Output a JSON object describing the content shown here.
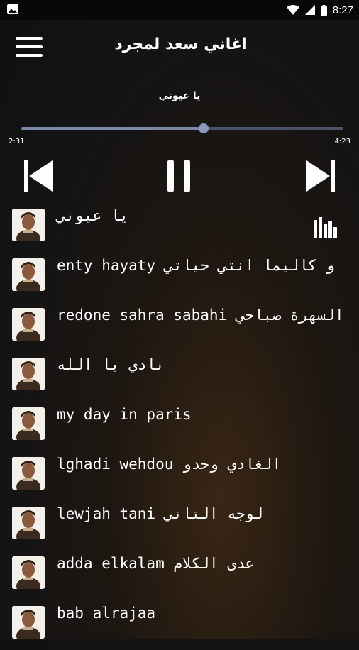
{
  "status_bar": {
    "time": "8:27"
  },
  "app_bar": {
    "title": "اغاني سعد لمجرد",
    "menu_icon": "hamburger-menu-icon"
  },
  "player": {
    "now_playing": "يا عيوني",
    "current_time": "2:31",
    "total_time": "4:23",
    "progress": 0.567,
    "controls": {
      "previous": "skip-previous-icon",
      "play_pause": "pause-icon",
      "next": "skip-next-icon"
    }
  },
  "playlist": [
    {
      "title": "يا عيوني",
      "playing": true
    },
    {
      "title": "enty hayaty و كاليما انتي حياتي"
    },
    {
      "title": "redone sahra sabahi السهرة صباحي"
    },
    {
      "title": "نادي يا الله"
    },
    {
      "title": "my day in paris"
    },
    {
      "title": "lghadi wehdou الغادي وحدو"
    },
    {
      "title": "lewjah tani لوجه التاني"
    },
    {
      "title": "adda elkalam عدى الكلام"
    },
    {
      "title": "bab alrajaa"
    }
  ],
  "colors": {
    "accent": "#8c99bd",
    "track": "#4a5266",
    "status_bar": "#080808"
  }
}
